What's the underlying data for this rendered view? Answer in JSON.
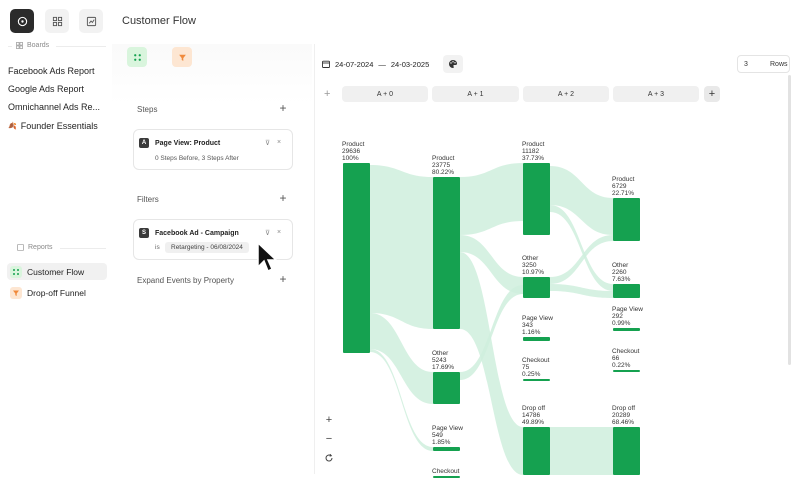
{
  "page": {
    "title": "Customer Flow"
  },
  "sidebar": {
    "boards_label": "Boards",
    "boards": [
      {
        "label": "Facebook Ads Report"
      },
      {
        "label": "Google Ads Report"
      },
      {
        "label": "Omnichannel Ads Re..."
      },
      {
        "label": "Founder Essentials",
        "emoji": "🍂"
      }
    ],
    "reports_label": "Reports",
    "reports": [
      {
        "label": "Customer Flow",
        "active": true
      },
      {
        "label": "Drop-off Funnel",
        "active": false
      }
    ]
  },
  "config": {
    "steps_title": "Steps",
    "step_card": {
      "badge": "A",
      "title": "Page View: Product",
      "subtitle": "0 Steps Before, 3 Steps After"
    },
    "filters_title": "Filters",
    "filter_card": {
      "badge": "S",
      "title": "Facebook Ad - Campaign",
      "operator": "is",
      "value": "Retargeting - 06/08/2024"
    },
    "expand_label": "Expand Events by Property"
  },
  "toolbar": {
    "date_start": "24-07-2024",
    "date_sep": "—",
    "date_end": "24-03-2025",
    "rows_value": "3",
    "rows_label": "Rows"
  },
  "columns": [
    "A + 0",
    "A + 1",
    "A + 2",
    "A + 3"
  ],
  "colors": {
    "node": "#15a150",
    "link": "#cfeedd",
    "active_report": "#d9f5dd",
    "funnel_icon": "#fde6d2"
  },
  "nodes": [
    {
      "col": 0,
      "name": "Product",
      "count": "29636",
      "pct": "100%"
    },
    {
      "col": 1,
      "name": "Product",
      "count": "23775",
      "pct": "80.22%"
    },
    {
      "col": 1,
      "name": "Other",
      "count": "5243",
      "pct": "17.69%"
    },
    {
      "col": 1,
      "name": "Page View",
      "count": "549",
      "pct": "1.85%"
    },
    {
      "col": 1,
      "name": "Checkout",
      "count": "",
      "pct": ""
    },
    {
      "col": 2,
      "name": "Product",
      "count": "11182",
      "pct": "37.73%"
    },
    {
      "col": 2,
      "name": "Other",
      "count": "3250",
      "pct": "10.97%"
    },
    {
      "col": 2,
      "name": "Page View",
      "count": "343",
      "pct": "1.16%"
    },
    {
      "col": 2,
      "name": "Checkout",
      "count": "75",
      "pct": "0.25%"
    },
    {
      "col": 2,
      "name": "Drop off",
      "count": "14786",
      "pct": "49.89%"
    },
    {
      "col": 3,
      "name": "Product",
      "count": "6729",
      "pct": "22.71%"
    },
    {
      "col": 3,
      "name": "Other",
      "count": "2260",
      "pct": "7.63%"
    },
    {
      "col": 3,
      "name": "Page View",
      "count": "292",
      "pct": "0.99%"
    },
    {
      "col": 3,
      "name": "Checkout",
      "count": "66",
      "pct": "0.22%"
    },
    {
      "col": 3,
      "name": "Drop off",
      "count": "20289",
      "pct": "68.46%"
    }
  ]
}
